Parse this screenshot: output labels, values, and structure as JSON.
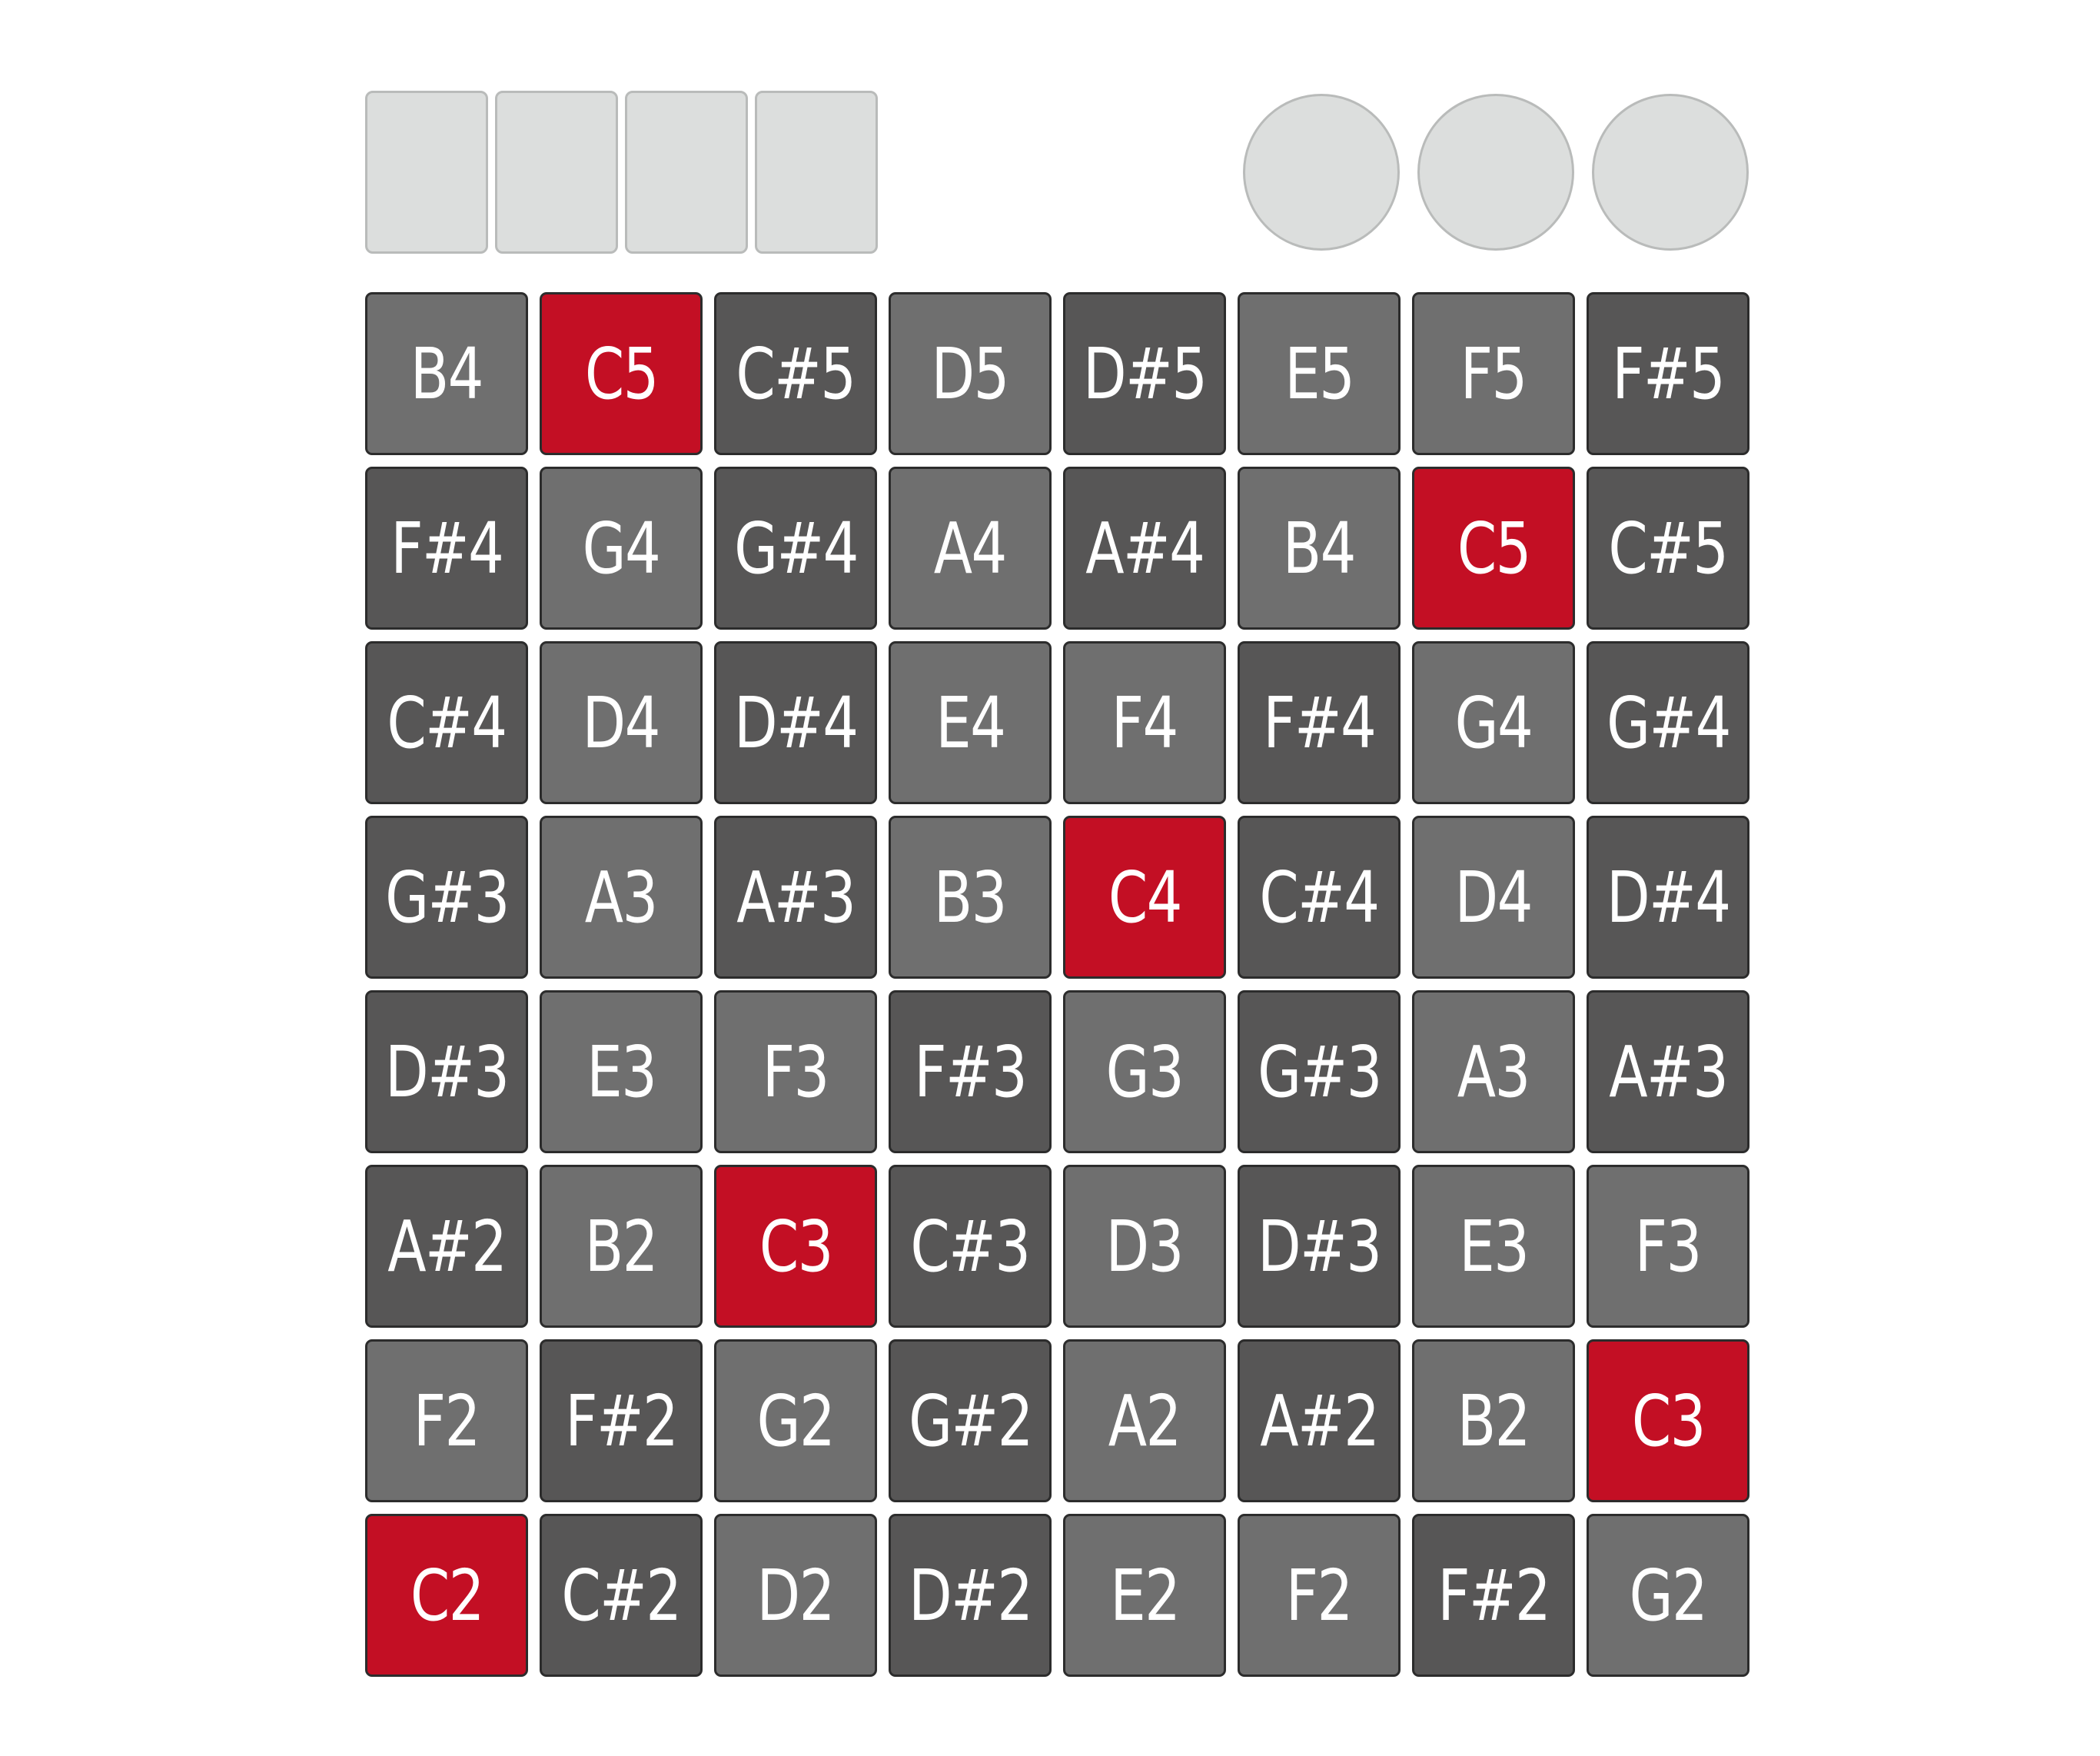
{
  "colors": {
    "light": "#6f6f6f",
    "dark": "#575656",
    "root": "#c30f24",
    "control": "#dcdedd"
  },
  "top_controls": {
    "rect_buttons": [
      "",
      "",
      "",
      ""
    ],
    "round_buttons": [
      "",
      "",
      ""
    ]
  },
  "grid": {
    "rows": [
      [
        {
          "note": "B4",
          "shade": "light"
        },
        {
          "note": "C5",
          "shade": "root"
        },
        {
          "note": "C#5",
          "shade": "dark"
        },
        {
          "note": "D5",
          "shade": "light"
        },
        {
          "note": "D#5",
          "shade": "dark"
        },
        {
          "note": "E5",
          "shade": "light"
        },
        {
          "note": "F5",
          "shade": "light"
        },
        {
          "note": "F#5",
          "shade": "dark"
        }
      ],
      [
        {
          "note": "F#4",
          "shade": "dark"
        },
        {
          "note": "G4",
          "shade": "light"
        },
        {
          "note": "G#4",
          "shade": "dark"
        },
        {
          "note": "A4",
          "shade": "light"
        },
        {
          "note": "A#4",
          "shade": "dark"
        },
        {
          "note": "B4",
          "shade": "light"
        },
        {
          "note": "C5",
          "shade": "root"
        },
        {
          "note": "C#5",
          "shade": "dark"
        }
      ],
      [
        {
          "note": "C#4",
          "shade": "dark"
        },
        {
          "note": "D4",
          "shade": "light"
        },
        {
          "note": "D#4",
          "shade": "dark"
        },
        {
          "note": "E4",
          "shade": "light"
        },
        {
          "note": "F4",
          "shade": "light"
        },
        {
          "note": "F#4",
          "shade": "dark"
        },
        {
          "note": "G4",
          "shade": "light"
        },
        {
          "note": "G#4",
          "shade": "dark"
        }
      ],
      [
        {
          "note": "G#3",
          "shade": "dark"
        },
        {
          "note": "A3",
          "shade": "light"
        },
        {
          "note": "A#3",
          "shade": "dark"
        },
        {
          "note": "B3",
          "shade": "light"
        },
        {
          "note": "C4",
          "shade": "root"
        },
        {
          "note": "C#4",
          "shade": "dark"
        },
        {
          "note": "D4",
          "shade": "light"
        },
        {
          "note": "D#4",
          "shade": "dark"
        }
      ],
      [
        {
          "note": "D#3",
          "shade": "dark"
        },
        {
          "note": "E3",
          "shade": "light"
        },
        {
          "note": "F3",
          "shade": "light"
        },
        {
          "note": "F#3",
          "shade": "dark"
        },
        {
          "note": "G3",
          "shade": "light"
        },
        {
          "note": "G#3",
          "shade": "dark"
        },
        {
          "note": "A3",
          "shade": "light"
        },
        {
          "note": "A#3",
          "shade": "dark"
        }
      ],
      [
        {
          "note": "A#2",
          "shade": "dark"
        },
        {
          "note": "B2",
          "shade": "light"
        },
        {
          "note": "C3",
          "shade": "root"
        },
        {
          "note": "C#3",
          "shade": "dark"
        },
        {
          "note": "D3",
          "shade": "light"
        },
        {
          "note": "D#3",
          "shade": "dark"
        },
        {
          "note": "E3",
          "shade": "light"
        },
        {
          "note": "F3",
          "shade": "light"
        }
      ],
      [
        {
          "note": "F2",
          "shade": "light"
        },
        {
          "note": "F#2",
          "shade": "dark"
        },
        {
          "note": "G2",
          "shade": "light"
        },
        {
          "note": "G#2",
          "shade": "dark"
        },
        {
          "note": "A2",
          "shade": "light"
        },
        {
          "note": "A#2",
          "shade": "dark"
        },
        {
          "note": "B2",
          "shade": "light"
        },
        {
          "note": "C3",
          "shade": "root"
        }
      ],
      [
        {
          "note": "C2",
          "shade": "root"
        },
        {
          "note": "C#2",
          "shade": "dark"
        },
        {
          "note": "D2",
          "shade": "light"
        },
        {
          "note": "D#2",
          "shade": "dark"
        },
        {
          "note": "E2",
          "shade": "light"
        },
        {
          "note": "F2",
          "shade": "light"
        },
        {
          "note": "F#2",
          "shade": "dark"
        },
        {
          "note": "G2",
          "shade": "light"
        }
      ]
    ]
  }
}
